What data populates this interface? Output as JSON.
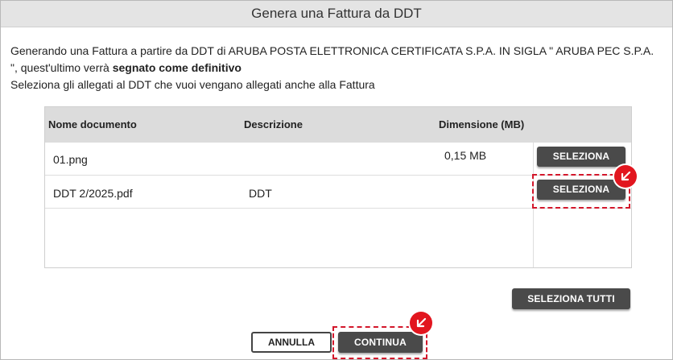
{
  "dialog": {
    "title": "Genera una Fattura da DDT",
    "message_line1": "Generando una Fattura a partire da DDT di ARUBA POSTA ELETTRONICA CERTIFICATA S.P.A. IN SIGLA \" ARUBA PEC S.P.A.",
    "message_line2_prefix": "\", quest'ultimo verrà ",
    "message_line2_bold": "segnato come definitivo",
    "message_line3": "Seleziona gli allegati al DDT che vuoi vengano allegati anche alla Fattura"
  },
  "table": {
    "headers": {
      "name": "Nome documento",
      "description": "Descrizione",
      "size": "Dimensione (MB)"
    },
    "rows": [
      {
        "name": "01.png",
        "description": "",
        "size": "0,15 MB",
        "action": "SELEZIONA"
      },
      {
        "name": "DDT 2/2025.pdf",
        "description": "DDT",
        "size": "",
        "action": "SELEZIONA"
      }
    ]
  },
  "buttons": {
    "select_all": "SELEZIONA TUTTI",
    "cancel": "ANNULLA",
    "continue": "CONTINUA"
  },
  "colors": {
    "highlight": "#d3172b",
    "marker": "#e2161f",
    "button_dark": "#4a4a4a"
  },
  "icons": {
    "marker_icon": "arrow-down-left-icon"
  }
}
